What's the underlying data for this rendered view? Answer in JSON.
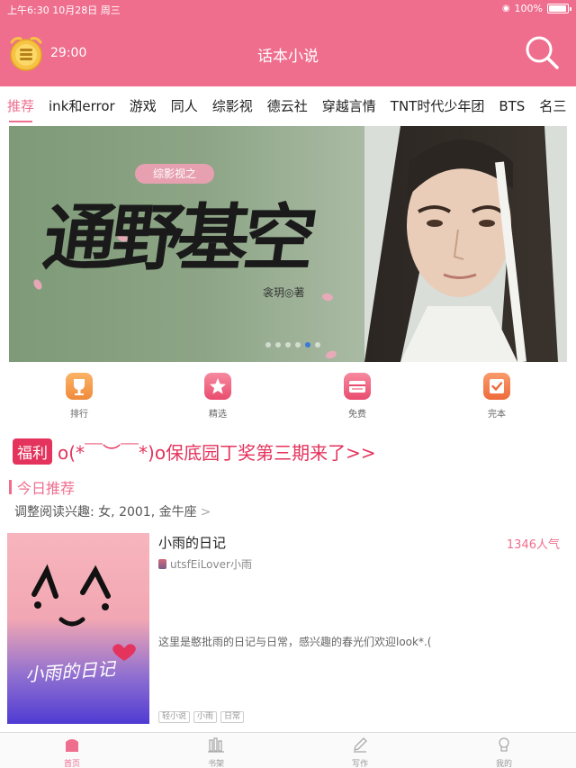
{
  "status_bar": {
    "time_date": "上午6:30 10月28日 周三",
    "battery": "100%"
  },
  "nav": {
    "timer": "29:00",
    "title": "话本小说"
  },
  "tabs": [
    {
      "label": "推荐",
      "active": true
    },
    {
      "label": "ink和error"
    },
    {
      "label": "游戏"
    },
    {
      "label": "同人"
    },
    {
      "label": "综影视"
    },
    {
      "label": "德云社"
    },
    {
      "label": "穿越言情"
    },
    {
      "label": "TNT时代少年团"
    },
    {
      "label": "BTS"
    },
    {
      "label": "名三"
    }
  ],
  "banner": {
    "tag": "综影视之",
    "title_calligraphy": "通野基空",
    "author": "衾玥◎著",
    "pager": {
      "count": 6,
      "active_index": 4
    }
  },
  "shortcuts": [
    {
      "label": "排行",
      "icon": "trophy-icon",
      "color": "#f7a15b"
    },
    {
      "label": "精选",
      "icon": "star-icon",
      "color": "#f2647e"
    },
    {
      "label": "免费",
      "icon": "free-icon",
      "color": "#f2647e"
    },
    {
      "label": "完本",
      "icon": "check-icon",
      "color": "#f4774e"
    }
  ],
  "promo": {
    "badge": "福利",
    "text": "o(*￣︶￣*)o保底园丁奖第三期来了>>"
  },
  "section": {
    "title": "今日推荐"
  },
  "preference": {
    "text": "调整阅读兴趣: 女, 2001, 金牛座",
    "chevron": ">"
  },
  "book": {
    "title": "小雨的日记",
    "popularity": "1346人气",
    "author": "utsfEiLover小雨",
    "description": "这里是憨批雨的日记与日常，感兴趣的春光们欢迎look*.(",
    "cover_title": "小雨的日记",
    "tags": [
      "轻小说",
      "小雨",
      "日常"
    ]
  },
  "tabbar": [
    {
      "label": "首页",
      "icon": "home-icon",
      "active": true
    },
    {
      "label": "书架",
      "icon": "bookshelf-icon"
    },
    {
      "label": "写作",
      "icon": "pen-icon"
    },
    {
      "label": "我的",
      "icon": "profile-icon"
    }
  ],
  "colors": {
    "accent": "#ef6e8e",
    "promo": "#e4335c"
  }
}
